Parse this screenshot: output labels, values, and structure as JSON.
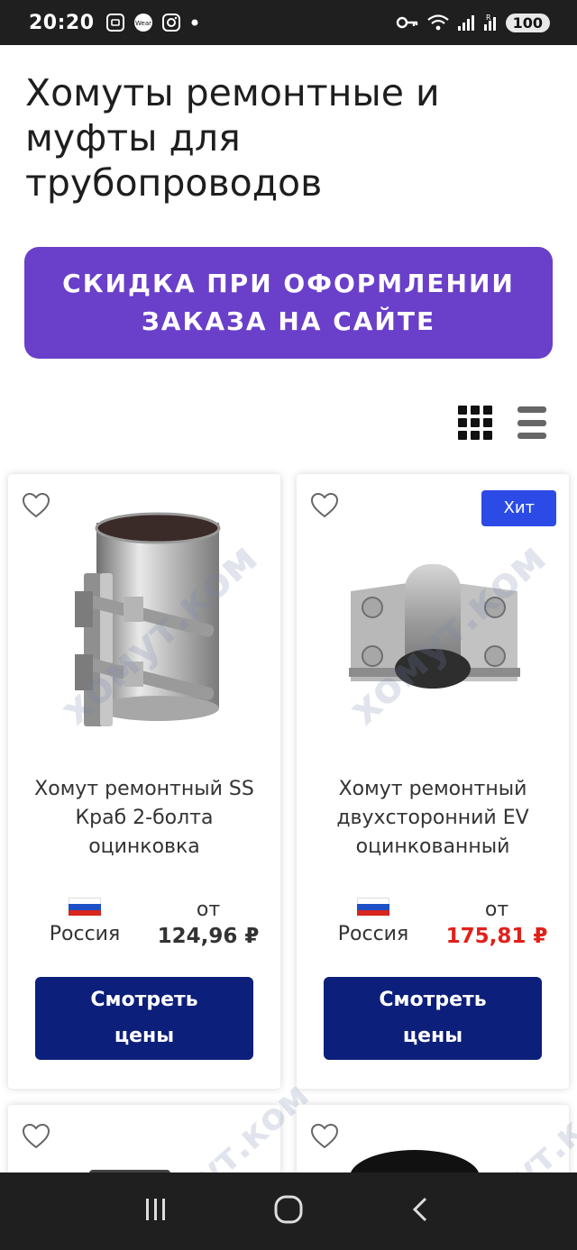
{
  "status_bar": {
    "time": "20:20",
    "battery": "100",
    "left_icons": [
      "screenshot-icon",
      "wear-icon",
      "instagram-icon",
      "dot-icon"
    ],
    "right_icons": [
      "key-icon",
      "wifi-icon",
      "signal-icon",
      "signal-r-icon"
    ]
  },
  "page": {
    "title": "Хомуты ремонтные и муфты для трубопроводов"
  },
  "promo": {
    "text": "СКИДКА ПРИ ОФОРМЛЕНИИ\nЗАКАЗА НА САЙТЕ",
    "color": "#6a3fc9"
  },
  "view_toggle": {
    "active": "grid",
    "icons": [
      "grid-view-icon",
      "list-view-icon"
    ]
  },
  "products": [
    {
      "name": "Хомут ремонтный SS Краб 2-болта оцинковка",
      "country": "Россия",
      "price_prefix": "от",
      "price": "124,96 ₽",
      "badge": "",
      "button_label": "Смотреть\nцены",
      "watermark": "хомут.ком"
    },
    {
      "name": "Хомут ремонтный двухсторонний EV оцинкованный",
      "country": "Россия",
      "price_prefix": "от",
      "price": "175,81 ₽",
      "badge": "Хит",
      "button_label": "Смотреть\nцены",
      "watermark": "хомут.ком"
    },
    {
      "watermark": "хомут.ком"
    },
    {
      "watermark": "хомут.ком"
    }
  ],
  "colors": {
    "button": "#0c1f7a",
    "badge": "#2c4be6",
    "price_hit": "#e0201b"
  },
  "nav_bar": {
    "icons": [
      "recent-apps-icon",
      "home-icon",
      "back-icon"
    ]
  }
}
